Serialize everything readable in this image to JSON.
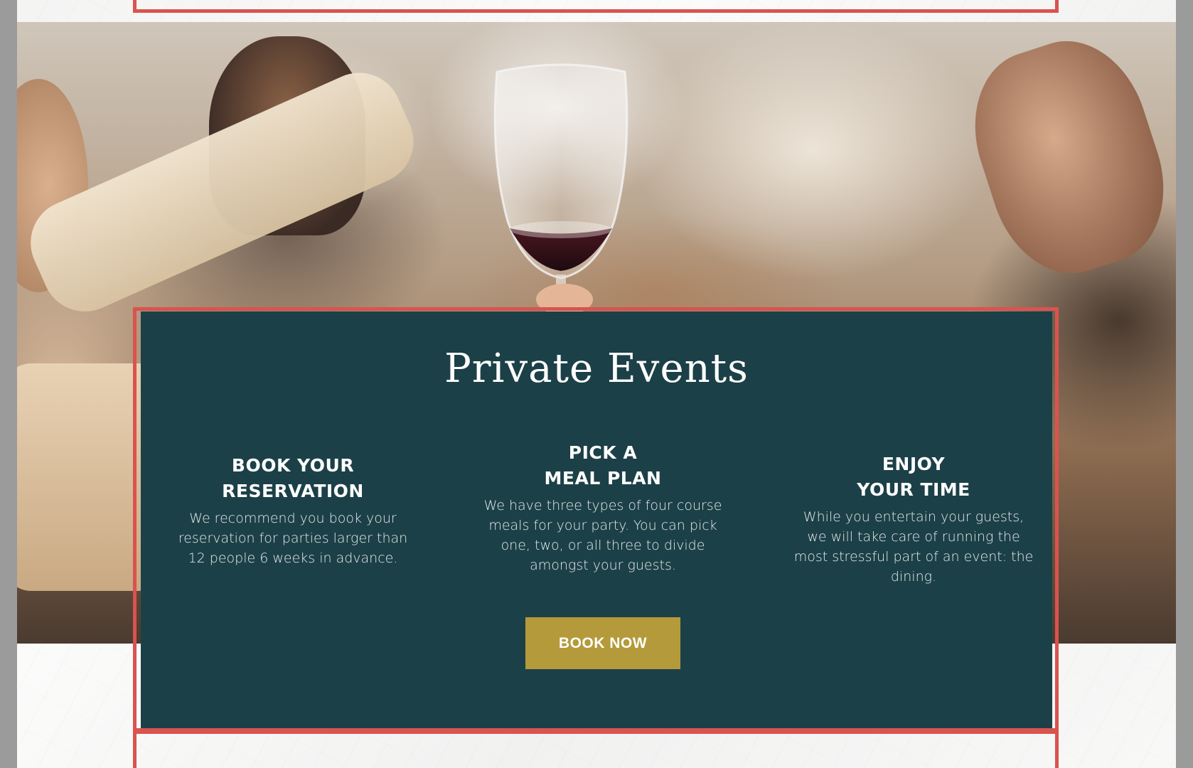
{
  "section": {
    "title": "Private Events"
  },
  "steps": [
    {
      "heading": "BOOK YOUR\nRESERVATION",
      "body": "We recommend you book your reservation for parties larger than 12 people 6 weeks in advance."
    },
    {
      "heading": "PICK A\nMEAL PLAN",
      "body": "We have three types of four course meals for your party. You can pick one, two, or all three to divide amongst your guests."
    },
    {
      "heading": "ENJOY\nYOUR TIME",
      "body": "While you entertain your guests, we will take care of running the most stressful part of an event: the dining."
    }
  ],
  "cta": {
    "label": "BOOK NOW"
  },
  "colors": {
    "panel": "#1c4047",
    "button": "#b49a3a",
    "frame": "#d9534f"
  }
}
